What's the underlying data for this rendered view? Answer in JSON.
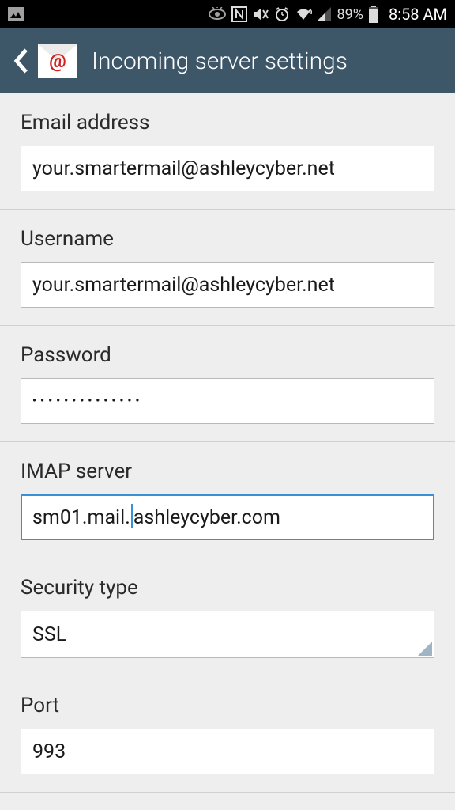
{
  "statusbar": {
    "battery_pct": "89%",
    "time": "8:58 AM"
  },
  "header": {
    "title": "Incoming server settings"
  },
  "form": {
    "email": {
      "label": "Email address",
      "value": "your.smartermail@ashleycyber.net"
    },
    "username": {
      "label": "Username",
      "value": "your.smartermail@ashleycyber.net"
    },
    "password": {
      "label": "Password",
      "value": "••••••••••••••"
    },
    "imap": {
      "label": "IMAP server",
      "value_pre": "sm01.mail.",
      "value_post": "ashleycyber.com"
    },
    "security": {
      "label": "Security type",
      "value": "SSL"
    },
    "port": {
      "label": "Port",
      "value": "993"
    }
  }
}
